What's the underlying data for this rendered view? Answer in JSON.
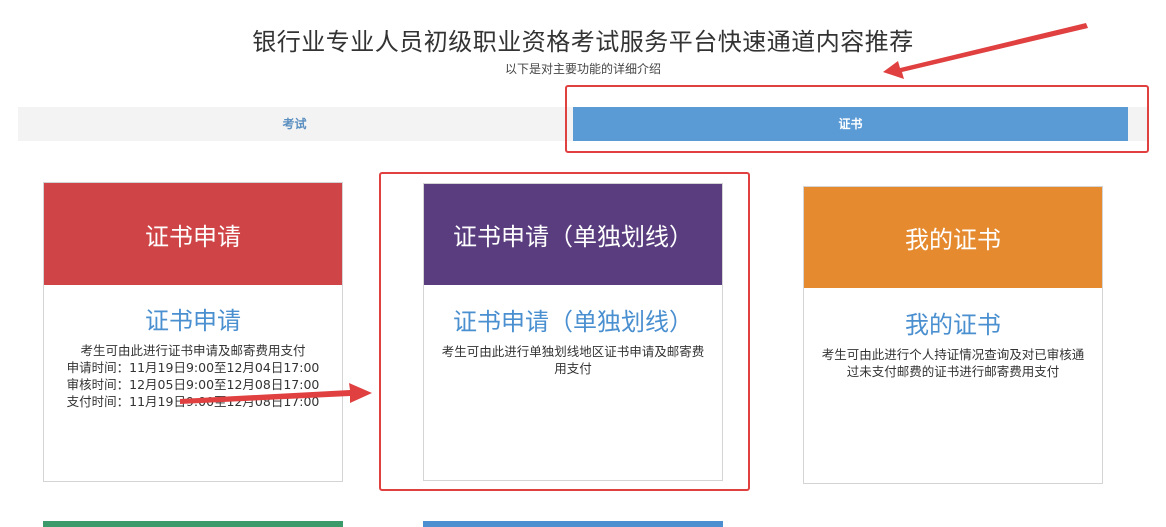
{
  "header": {
    "title": "银行业专业人员初级职业资格考试服务平台快速通道内容推荐",
    "subtitle": "以下是对主要功能的详细介绍"
  },
  "tabs": [
    {
      "label": "考试",
      "active": false
    },
    {
      "label": "证书",
      "active": true
    }
  ],
  "cards": [
    {
      "head": "证书申请",
      "title": "证书申请",
      "desc_lines": [
        "考生可由此进行证书申请及邮寄费用支付",
        "申请时间：11月19日9:00至12月04日17:00",
        "审核时间：12月05日9:00至12月08日17:00",
        "支付时间：11月19日9:00至12月08日17:00"
      ],
      "color": "#cf4447"
    },
    {
      "head": "证书申请（单独划线）",
      "title": "证书申请（单独划线）",
      "desc_lines": [
        "考生可由此进行单独划线地区证书申请及邮寄费",
        "用支付"
      ],
      "color": "#593d7e"
    },
    {
      "head": "我的证书",
      "title": "我的证书",
      "desc_lines": [
        "考生可由此进行个人持证情况查询及对已审核通",
        "过未支付邮费的证书进行邮寄费用支付"
      ],
      "color": "#e58a2e"
    }
  ],
  "annotations": {
    "highlight_color": "#e04040"
  }
}
